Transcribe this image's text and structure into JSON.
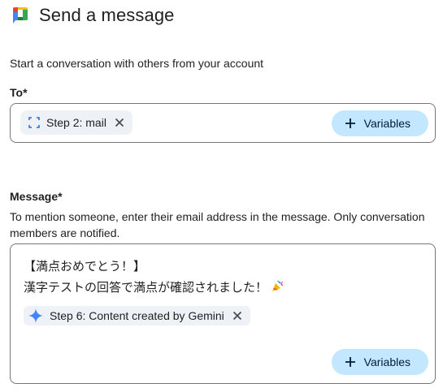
{
  "header": {
    "title": "Send a message",
    "logo_icon": "google-chat-logo-icon"
  },
  "subtitle": "Start a conversation with others from your account",
  "to": {
    "label": "To*",
    "chip": {
      "icon": "variable-bracket-icon",
      "label": "Step 2: mail",
      "remove_icon": "close-icon"
    },
    "variables_button": {
      "icon": "plus-icon",
      "label": "Variables"
    }
  },
  "message": {
    "label": "Message*",
    "help_text": "To mention someone, enter their email address in the message. Only conversation members are notified.",
    "lines": [
      "【満点おめでとう！】",
      "漢字テストの回答で満点が確認されました！"
    ],
    "emoji_icon": "party-popper-icon",
    "chip": {
      "icon": "gemini-sparkle-icon",
      "label": "Step 6: Content created by Gemini",
      "remove_icon": "close-icon"
    },
    "variables_button": {
      "icon": "plus-icon",
      "label": "Variables"
    }
  },
  "colors": {
    "chip_bg": "#eef2f7",
    "button_bg": "#c2e7ff",
    "button_text": "#001d35",
    "gemini_blue": "#4285f4"
  }
}
